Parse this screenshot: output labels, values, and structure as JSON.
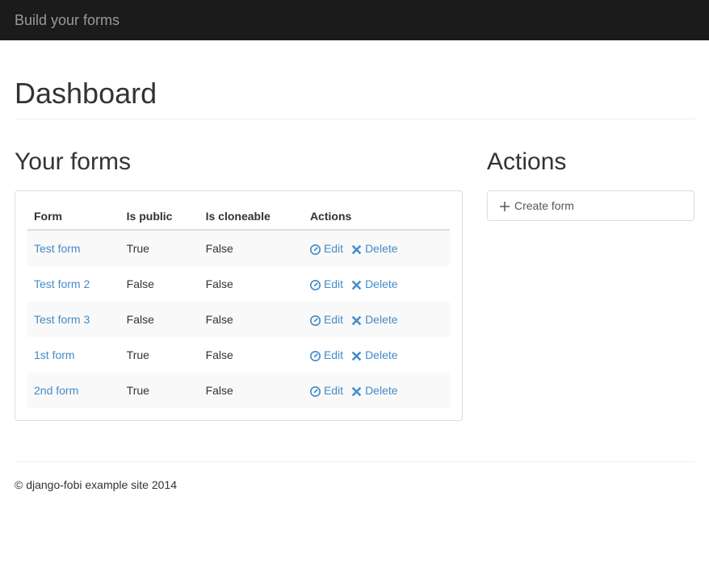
{
  "navbar": {
    "brand": "Build your forms"
  },
  "page": {
    "title": "Dashboard"
  },
  "sections": {
    "forms_title": "Your forms",
    "actions_title": "Actions"
  },
  "table": {
    "headers": {
      "form": "Form",
      "is_public": "Is public",
      "is_cloneable": "Is cloneable",
      "actions": "Actions"
    },
    "action_labels": {
      "edit": "Edit",
      "delete": "Delete"
    },
    "rows": [
      {
        "name": "Test form",
        "is_public": "True",
        "is_cloneable": "False"
      },
      {
        "name": "Test form 2",
        "is_public": "False",
        "is_cloneable": "False"
      },
      {
        "name": "Test form 3",
        "is_public": "False",
        "is_cloneable": "False"
      },
      {
        "name": "1st form",
        "is_public": "True",
        "is_cloneable": "False"
      },
      {
        "name": "2nd form",
        "is_public": "True",
        "is_cloneable": "False"
      }
    ]
  },
  "sidebar": {
    "create_form": "Create form"
  },
  "footer": {
    "text": "© django-fobi example site 2014"
  }
}
